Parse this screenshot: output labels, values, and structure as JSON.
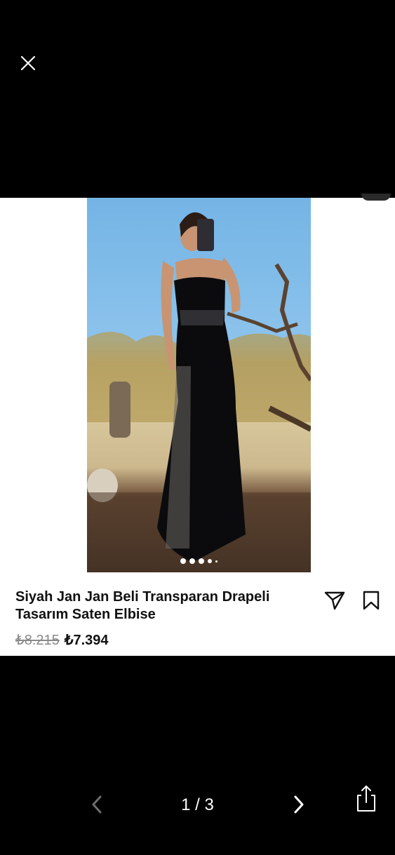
{
  "colors": {
    "background": "#000000",
    "card": "#ffffff",
    "old_price": "#8a8a8a",
    "text": "#111111"
  },
  "viewer": {
    "close_icon": "close-icon"
  },
  "product": {
    "title": "Siyah Jan Jan Beli Transparan Drapeli Tasarım Saten Elbise",
    "old_price": "₺8.215",
    "new_price": "₺7.394",
    "image_dots": {
      "count": 5,
      "active_index": 0
    },
    "actions": [
      "share-icon",
      "bookmark-icon"
    ]
  },
  "pager": {
    "indicator": "1 / 3",
    "icons": [
      "chevron-left-icon",
      "chevron-right-icon",
      "share-sheet-icon"
    ]
  }
}
